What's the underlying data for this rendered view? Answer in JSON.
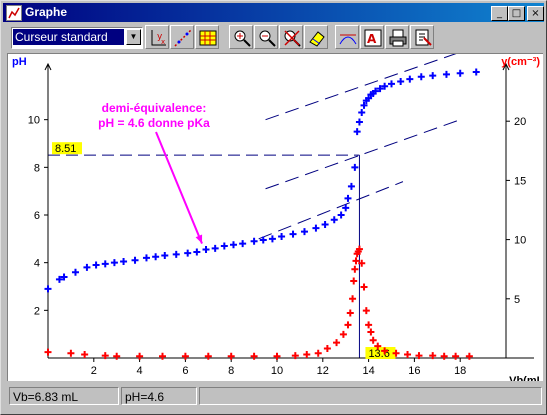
{
  "window": {
    "title": "Graphe"
  },
  "titlebar_buttons": {
    "minimize": "_",
    "maximize": "□",
    "close": "×"
  },
  "toolbar": {
    "cursor_mode": "Curseur standard",
    "icons": [
      "scale-axes-icon",
      "draw-line-icon",
      "grid-table-icon",
      "zoom-in-icon",
      "zoom-out-icon",
      "zoom-cancel-icon",
      "erase-icon",
      "tangent-icon",
      "text-annotation-icon",
      "print-icon",
      "export-icon"
    ]
  },
  "status": {
    "vb": "Vb=6.83 mL",
    "ph": "pH=4.6"
  },
  "colors": {
    "ph_series": "#0000ff",
    "derivative_series": "#ff0000",
    "annotation": "#ff00ff",
    "label_bg": "#ffff00"
  },
  "chart_data": {
    "type": "scatter",
    "left_axis": {
      "label": "pH",
      "range": [
        0,
        12
      ],
      "ticks": [
        "2",
        "4",
        "6",
        "8",
        "10"
      ]
    },
    "right_axis": {
      "label": "y(cm⁻³)",
      "range": [
        0,
        25
      ],
      "ticks": [
        "5",
        "10",
        "15",
        "20"
      ]
    },
    "x_axis": {
      "label": "Vb(mL)",
      "range": [
        0,
        20
      ],
      "ticks": [
        "2",
        "4",
        "6",
        "8",
        "10",
        "12",
        "14",
        "16",
        "18"
      ]
    },
    "series": [
      {
        "axis": "left",
        "color": "#0000ff",
        "marker": "+",
        "points": [
          [
            0,
            2.9
          ],
          [
            0.5,
            3.3
          ],
          [
            0.7,
            3.4
          ],
          [
            1.2,
            3.6
          ],
          [
            1.7,
            3.8
          ],
          [
            2.1,
            3.9
          ],
          [
            2.5,
            3.95
          ],
          [
            2.9,
            4.0
          ],
          [
            3.3,
            4.05
          ],
          [
            3.8,
            4.1
          ],
          [
            4.3,
            4.2
          ],
          [
            4.7,
            4.25
          ],
          [
            5.1,
            4.3
          ],
          [
            5.6,
            4.35
          ],
          [
            6.1,
            4.4
          ],
          [
            6.5,
            4.45
          ],
          [
            6.9,
            4.55
          ],
          [
            7.3,
            4.6
          ],
          [
            7.7,
            4.7
          ],
          [
            8.1,
            4.75
          ],
          [
            8.5,
            4.8
          ],
          [
            9.0,
            4.9
          ],
          [
            9.4,
            4.95
          ],
          [
            9.8,
            5.0
          ],
          [
            10.2,
            5.1
          ],
          [
            10.7,
            5.2
          ],
          [
            11.2,
            5.3
          ],
          [
            11.7,
            5.45
          ],
          [
            12.1,
            5.6
          ],
          [
            12.5,
            5.8
          ],
          [
            12.8,
            6.0
          ],
          [
            13.0,
            6.3
          ],
          [
            13.1,
            6.7
          ],
          [
            13.25,
            7.2
          ],
          [
            13.4,
            8.0
          ],
          [
            13.5,
            9.5
          ],
          [
            13.6,
            9.9
          ],
          [
            13.7,
            10.3
          ],
          [
            13.8,
            10.6
          ],
          [
            13.9,
            10.8
          ],
          [
            14.0,
            10.9
          ],
          [
            14.1,
            11.05
          ],
          [
            14.2,
            11.1
          ],
          [
            14.3,
            11.2
          ],
          [
            14.5,
            11.3
          ],
          [
            14.7,
            11.4
          ],
          [
            15.0,
            11.5
          ],
          [
            15.4,
            11.6
          ],
          [
            15.8,
            11.7
          ],
          [
            16.3,
            11.8
          ],
          [
            16.8,
            11.85
          ],
          [
            17.4,
            11.9
          ],
          [
            18.0,
            11.95
          ],
          [
            18.7,
            12.0
          ]
        ]
      },
      {
        "axis": "right",
        "color": "#ff0000",
        "marker": "+",
        "points": [
          [
            0,
            0.5
          ],
          [
            1,
            0.4
          ],
          [
            1.6,
            0.3
          ],
          [
            2.5,
            0.2
          ],
          [
            3,
            0.15
          ],
          [
            4,
            0.15
          ],
          [
            5,
            0.15
          ],
          [
            6,
            0.15
          ],
          [
            7,
            0.15
          ],
          [
            8,
            0.15
          ],
          [
            9,
            0.15
          ],
          [
            10,
            0.15
          ],
          [
            10.8,
            0.2
          ],
          [
            11.3,
            0.3
          ],
          [
            11.8,
            0.4
          ],
          [
            12.2,
            0.8
          ],
          [
            12.6,
            1.3
          ],
          [
            12.9,
            2.0
          ],
          [
            13.1,
            2.8
          ],
          [
            13.2,
            3.8
          ],
          [
            13.3,
            5.0
          ],
          [
            13.35,
            6.5
          ],
          [
            13.4,
            7.5
          ],
          [
            13.45,
            8.2
          ],
          [
            13.5,
            8.8
          ],
          [
            13.55,
            9.0
          ],
          [
            13.6,
            9.2
          ],
          [
            13.7,
            8.0
          ],
          [
            13.8,
            6.0
          ],
          [
            13.9,
            4.0
          ],
          [
            14.0,
            2.8
          ],
          [
            14.1,
            2.2
          ],
          [
            14.2,
            1.5
          ],
          [
            14.4,
            1.0
          ],
          [
            14.7,
            0.6
          ],
          [
            15.2,
            0.4
          ],
          [
            15.7,
            0.3
          ],
          [
            16.2,
            0.2
          ],
          [
            16.8,
            0.2
          ],
          [
            17.3,
            0.15
          ],
          [
            17.8,
            0.15
          ],
          [
            18.4,
            0.15
          ]
        ]
      }
    ],
    "guides": {
      "ph_line_value": 8.51,
      "ph_label": "8.51",
      "vb_line_value": 13.6,
      "vb_label": "13.6",
      "dashed_parallels": [
        [
          [
            9.2,
            5.0
          ],
          [
            15.5,
            7.4
          ]
        ],
        [
          [
            9.5,
            10.0
          ],
          [
            18.5,
            13.0
          ]
        ],
        [
          [
            9.5,
            7.1
          ],
          [
            18.0,
            10.0
          ]
        ]
      ]
    },
    "annotation": {
      "lines": [
        "demi-équivalence:",
        "pH = 4.6 donne pKa"
      ],
      "arrow_to": [
        6.9,
        4.55
      ]
    }
  }
}
